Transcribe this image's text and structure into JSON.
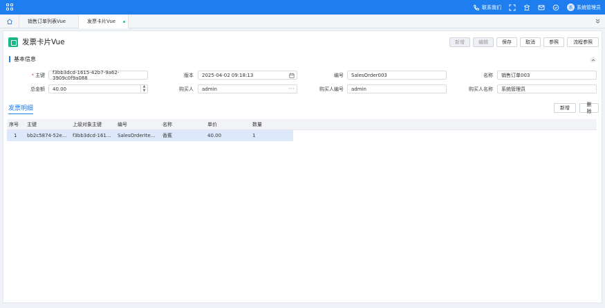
{
  "topbar": {
    "contact_label": "联系我们",
    "user_name": "系统管理员",
    "avatar_text": "系",
    "accent": "#1e7ef0"
  },
  "tabs": [
    {
      "label": "销售订单列表Vue"
    },
    {
      "label": "发票卡片Vue"
    }
  ],
  "page": {
    "title": "发票卡片Vue",
    "toolbar": {
      "add": "新增",
      "edit": "编辑",
      "save": "保存",
      "cancel": "取消",
      "ref": "参照",
      "flow_ref": "流程参照"
    }
  },
  "basic_info": {
    "section_title": "基本信息",
    "fields": {
      "pk_label": "主键",
      "pk_value": "f3bb3dcd-1615-42b7-9a62-3909c0f9a088",
      "version_label": "版本",
      "version_value": "2025-04-02 09:18:13",
      "code_label": "编号",
      "code_value": "SalesOrder003",
      "name_label": "名称",
      "name_value": "销售订单003",
      "total_label": "总金额",
      "total_value": "40.00",
      "buyer_label": "购买人",
      "buyer_value": "admin",
      "buyer_code_label": "购买人编号",
      "buyer_code_value": "admin",
      "buyer_name_label": "购买人名称",
      "buyer_name_value": "系统管理员"
    }
  },
  "detail": {
    "title": "发票明细",
    "add_button": "新增",
    "delete_button": "删除",
    "columns": [
      "序号",
      "主键",
      "上级对象主键",
      "编号",
      "名称",
      "单价",
      "数量"
    ],
    "rows": [
      [
        "1",
        "bb2c5874-52e...",
        "f3bb3dcd-161...",
        "SalesOrderIte...",
        "香蕉",
        "40.00",
        "1"
      ]
    ]
  },
  "icons": [
    "apps-icon",
    "phone-icon",
    "expand-icon",
    "tools-icon",
    "mail-icon",
    "check-circle-icon",
    "home-icon",
    "double-chevron-down-icon",
    "calendar-icon",
    "chevron-up-icon"
  ]
}
